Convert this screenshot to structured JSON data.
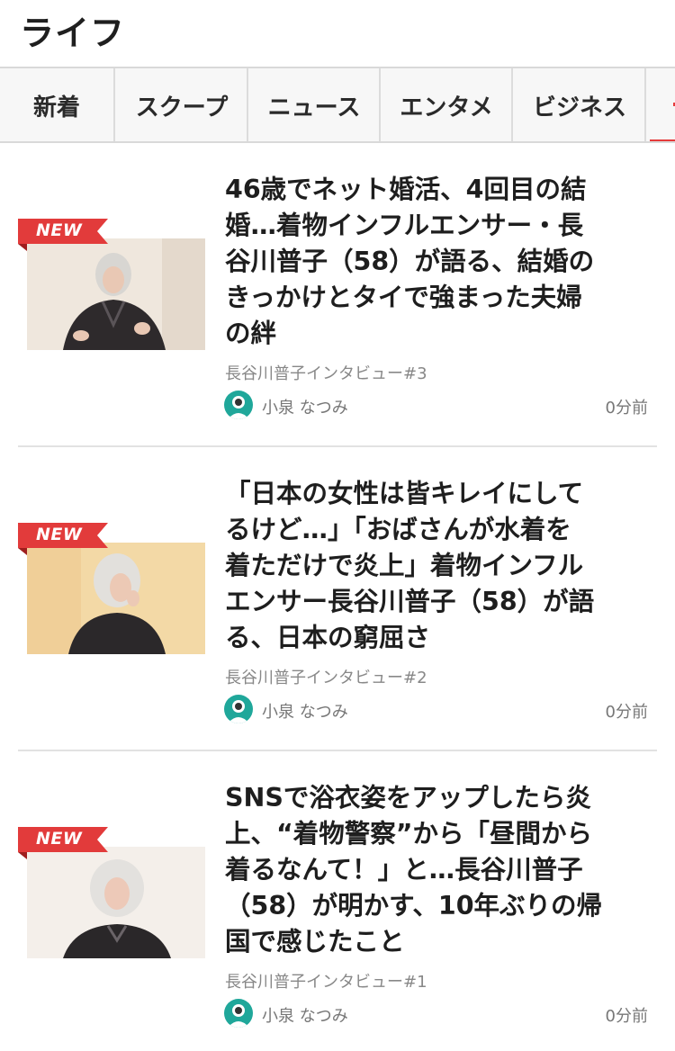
{
  "header": {
    "title": "ライフ"
  },
  "tabs": [
    {
      "label": "新着"
    },
    {
      "label": "スクープ"
    },
    {
      "label": "ニュース"
    },
    {
      "label": "エンタメ"
    },
    {
      "label": "ビジネス"
    }
  ],
  "colors": {
    "accent": "#e53b3b",
    "avatar_bg": "#1fa79a"
  },
  "articles": [
    {
      "badge": "NEW",
      "lines": [
        "46歳でネット婚活、4回目の結",
        "婚…着物インフルエンサー・長",
        "谷川普子（58）が語る、結婚の",
        "きっかけとタイで強まった夫婦",
        "の絆"
      ],
      "series": "長谷川普子インタビュー#3",
      "author": "小泉 なつみ",
      "time": "0分前"
    },
    {
      "badge": "NEW",
      "lines": [
        "「日本の女性は皆キレイにして",
        "るけど…」「おばさんが水着を",
        "着ただけで炎上」着物インフル",
        "エンサー長谷川普子（58）が語",
        "る、日本の窮屈さ"
      ],
      "series": "長谷川普子インタビュー#2",
      "author": "小泉 なつみ",
      "time": "0分前"
    },
    {
      "badge": "NEW",
      "lines": [
        "SNSで浴衣姿をアップしたら炎",
        "上、“着物警察”から「昼間から",
        "着るなんて！」と…長谷川普子",
        "（58）が明かす、10年ぶりの帰",
        "国で感じたこと"
      ],
      "series": "長谷川普子インタビュー#1",
      "author": "小泉 なつみ",
      "time": "0分前"
    }
  ]
}
